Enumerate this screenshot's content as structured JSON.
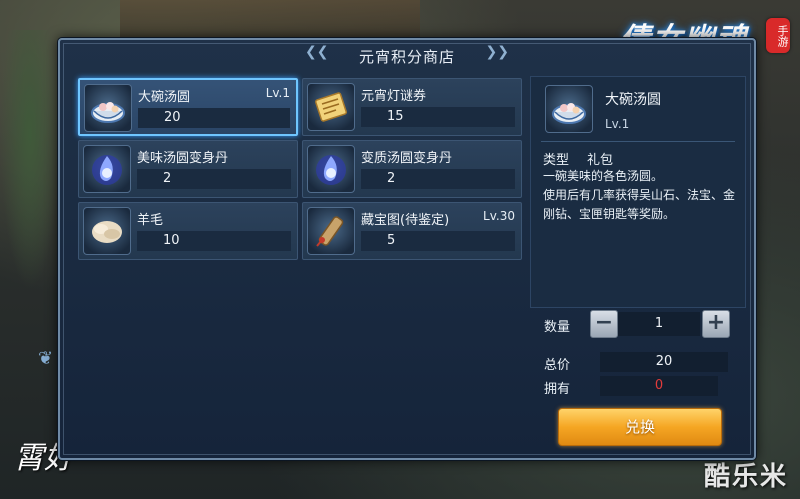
{
  "shop": {
    "title": "元宵积分商店"
  },
  "items": [
    {
      "name": "大碗汤圆",
      "level": "Lv.1",
      "price": "20",
      "icon": "tangyuan-bowl-icon",
      "selected": true
    },
    {
      "name": "元宵灯谜券",
      "level": "",
      "price": "15",
      "icon": "scroll-ticket-icon",
      "selected": false
    },
    {
      "name": "美味汤圆变身丹",
      "level": "",
      "price": "2",
      "icon": "blue-flame-pill-icon",
      "selected": false
    },
    {
      "name": "变质汤圆变身丹",
      "level": "",
      "price": "2",
      "icon": "blue-flame-pill-icon",
      "selected": false
    },
    {
      "name": "羊毛",
      "level": "",
      "price": "10",
      "icon": "wool-icon",
      "selected": false
    },
    {
      "name": "藏宝图(待鉴定)",
      "level": "Lv.30",
      "price": "5",
      "icon": "treasure-map-icon",
      "selected": false
    }
  ],
  "detail": {
    "name": "大碗汤圆",
    "level": "Lv.1",
    "type_label": "类型",
    "type_value": "礼包",
    "description_line1": "一碗美味的各色汤圆。",
    "description_line2": "使用后有几率获得吴山石、法宝、金刚钻、宝匣钥匙等奖励。"
  },
  "purchase": {
    "qty_label": "数量",
    "qty_value": "1",
    "minus": "−",
    "plus": "+",
    "total_label": "总价",
    "total_value": "20",
    "own_label": "拥有",
    "own_value": "0",
    "exchange_label": "兑换"
  },
  "branding": {
    "logo": "倩女幽魂",
    "logo_badge": "手游",
    "brush_text": "霄好",
    "watermark": "酷乐米"
  },
  "colors": {
    "accent_selected": "#6fc6ff",
    "exchange_button": "#f5a623",
    "own_value_color": "#e33b3b"
  }
}
